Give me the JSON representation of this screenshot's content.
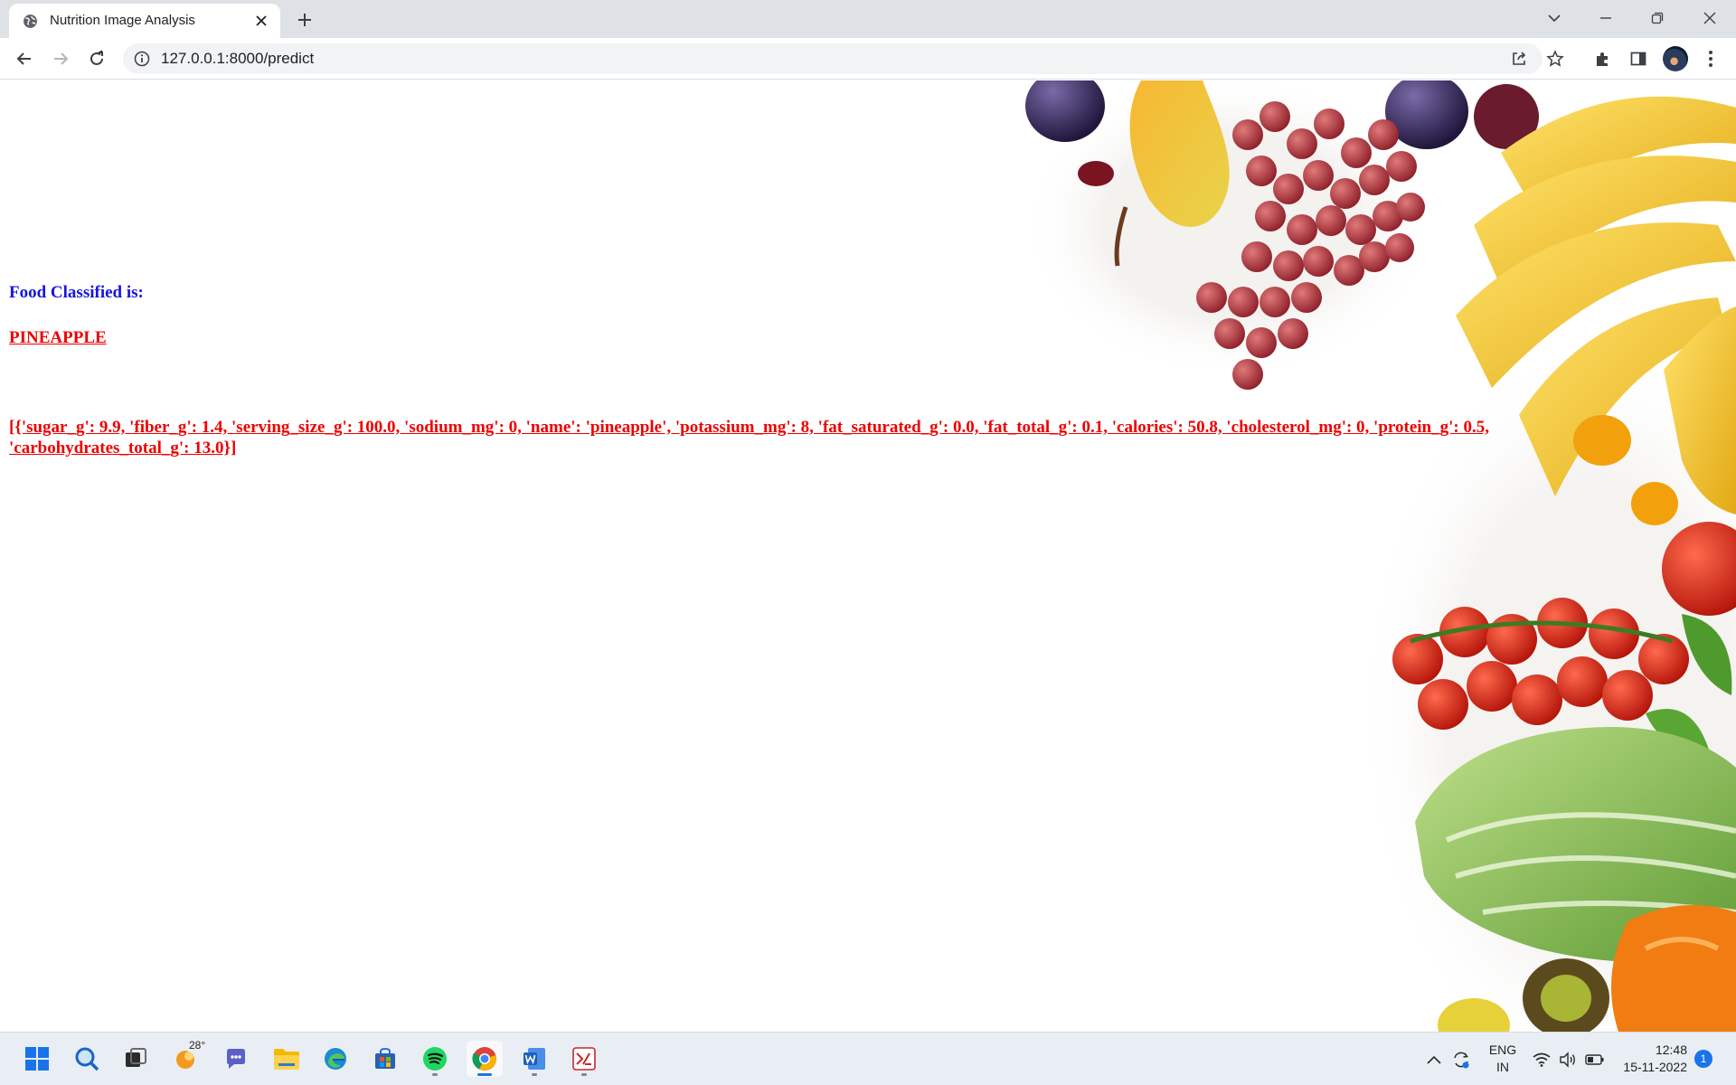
{
  "browser": {
    "tab": {
      "title": "Nutrition Image Analysis"
    },
    "address_bar": {
      "url": "127.0.0.1:8000/predict"
    }
  },
  "page": {
    "heading": "Food Classified is:",
    "result": "PINEAPPLE",
    "nutrition_json": "[{'sugar_g': 9.9, 'fiber_g': 1.4, 'serving_size_g': 100.0, 'sodium_mg': 0, 'name': 'pineapple', 'potassium_mg': 8, 'fat_saturated_g': 0.0, 'fat_total_g': 0.1, 'calories': 50.8, 'cholesterol_mg': 0, 'protein_g': 0.5, 'carbohydrates_total_g': 13.0}]",
    "colors": {
      "heading": "#1515e0",
      "result": "#ee0000"
    }
  },
  "taskbar": {
    "apps": [
      "start-icon",
      "search-icon",
      "task-view-icon",
      "weather-icon",
      "teams-chat-icon",
      "file-explorer-icon",
      "edge-icon",
      "store-icon",
      "spotify-icon",
      "chrome-icon",
      "word-icon",
      "app-icon"
    ],
    "weather_temp": "28°",
    "language": {
      "line1": "ENG",
      "line2": "IN"
    },
    "clock": {
      "time": "12:48",
      "date": "15-11-2022"
    },
    "notification_count": "1"
  }
}
